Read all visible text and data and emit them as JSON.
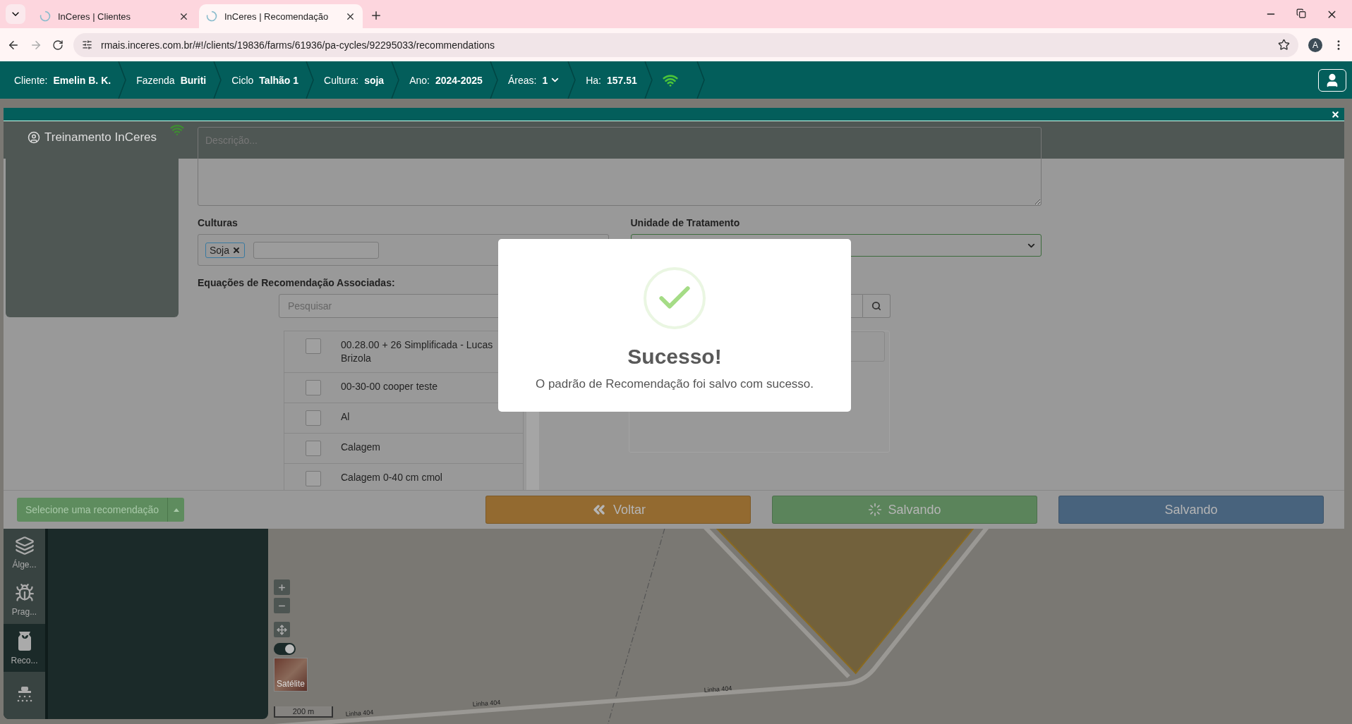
{
  "browser": {
    "tabs": [
      {
        "title": "InCeres | Clientes",
        "selected": false
      },
      {
        "title": "InCeres | Recomendação",
        "selected": true
      }
    ],
    "url": "rmais.inceres.com.br/#!/clients/19836/farms/61936/pa-cycles/92295033/recommendations",
    "profile_initial": "A"
  },
  "header": {
    "items": [
      {
        "label": "Cliente:",
        "value": "Emelin B. K.",
        "dropdown": false
      },
      {
        "label": "Fazenda",
        "value": "Buriti",
        "dropdown": false
      },
      {
        "label": "Ciclo",
        "value": "Talhão 1",
        "dropdown": false
      },
      {
        "label": "Cultura:",
        "value": "soja",
        "dropdown": false
      },
      {
        "label": "Ano:",
        "value": "2024-2025",
        "dropdown": false
      },
      {
        "label": "Áreas:",
        "value": "1",
        "dropdown": true
      },
      {
        "label": "Ha:",
        "value": "157.51",
        "dropdown": false
      }
    ],
    "online": true
  },
  "user_menu": {
    "name": "Treinamento InCeres"
  },
  "form": {
    "description_placeholder": "Descrição...",
    "cultures_label": "Culturas",
    "culture_tags": [
      "Soja"
    ],
    "treatment_label": "Unidade de Tratamento",
    "equations_label": "Equações de Recomendação Associadas:",
    "search_placeholder": "Pesquisar",
    "equations": [
      {
        "name": "00.28.00 + 26 Simplificada - Lucas Brizola",
        "checked": false
      },
      {
        "name": "00-30-00 cooper teste",
        "checked": false
      },
      {
        "name": "Al",
        "checked": false
      },
      {
        "name": "Calagem",
        "checked": false
      },
      {
        "name": "Calagem 0-40 cm cmol",
        "checked": false
      }
    ]
  },
  "footer": {
    "select_recommendation": "Selecione uma recomendação",
    "buttons": [
      {
        "kind": "back",
        "label": "Voltar"
      },
      {
        "kind": "saving",
        "label": "Salvando"
      },
      {
        "kind": "primary",
        "label": "Salvando"
      }
    ]
  },
  "sidebar": {
    "items": [
      {
        "kind": "layers",
        "label": "Álge...",
        "selected": false
      },
      {
        "kind": "pest",
        "label": "Prag...",
        "selected": false
      },
      {
        "kind": "fertilizer",
        "label": "Reco...",
        "selected": true
      },
      {
        "kind": "sprayer",
        "selected": false
      }
    ]
  },
  "map": {
    "toggle_on": true,
    "layer_label": "Satélite",
    "scale": "200 m",
    "road_labels": [
      "Linha 404",
      "Linha 404",
      "Linha 404"
    ]
  },
  "dialog": {
    "title": "Sucesso!",
    "message": "O padrão de Recomendação foi salvo com sucesso."
  }
}
